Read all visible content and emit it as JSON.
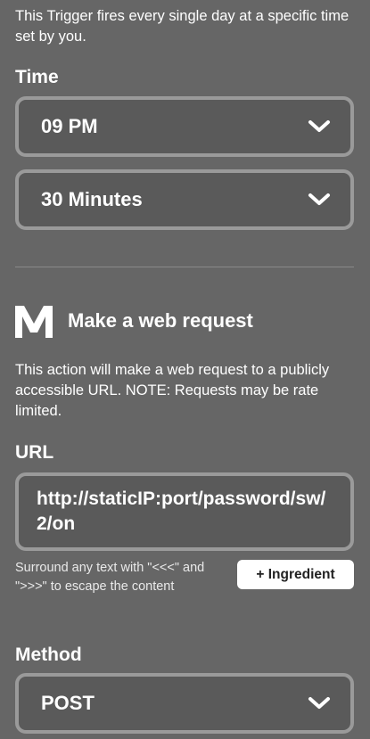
{
  "trigger": {
    "description": "This Trigger fires every single day at a specific time set by you.",
    "time_label": "Time",
    "hour_value": "09 PM",
    "minute_value": "30 Minutes"
  },
  "action": {
    "icon": "maker-webhooks-logo",
    "title": "Make a web request",
    "description": "This action will make a web request to a publicly accessible URL. NOTE: Requests may be rate limited.",
    "url_label": "URL",
    "url_value": "http://staticIP:port/password/sw/2/on",
    "hint": "Surround any text with \"<<<\" and \">>>\" to escape the content",
    "ingredient_button": "+ Ingredient",
    "method_label": "Method",
    "method_value": "POST"
  },
  "colors": {
    "background": "#666666",
    "field_border": "#9a9a9a",
    "text": "#ffffff"
  }
}
